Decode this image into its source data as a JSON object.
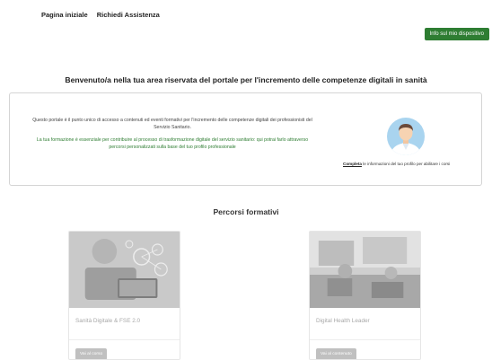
{
  "nav": {
    "home": "Pagina iniziale",
    "assistance": "Richiedi Assistenza"
  },
  "device_button": "Info sul mio dispositivo",
  "welcome": "Benvenuto/a nella tua area riservata del portale per l'incremento delle competenze digitali in sanità",
  "info": {
    "intro": "Questo portale è il punto unico di accesso a contenuti ed eventi formativi per l'incremento delle competenze digitali dei professionisti del Servizio Sanitario.",
    "highlight": "La tua formazione è essenziale per contribuire al processo di trasformazione digitale del servizio sanitario: qui potrai farlo attraverso percorsi personalizzati sulla base del tuo profilo professionale",
    "complete_link": "Completa",
    "complete_text": " le informazioni del tuo profilo per abilitare i corsi"
  },
  "section_title": "Percorsi formativi",
  "cards": [
    {
      "title": "Sanità Digitale & FSE 2.0",
      "button": "Vai al corso"
    },
    {
      "title": "Digital Health Leader",
      "button": "Vai al contenuto"
    }
  ],
  "colors": {
    "accent_green": "#2e7d32",
    "button_gray": "#c0c0c0"
  },
  "icons": {
    "avatar": "user-avatar-icon"
  }
}
